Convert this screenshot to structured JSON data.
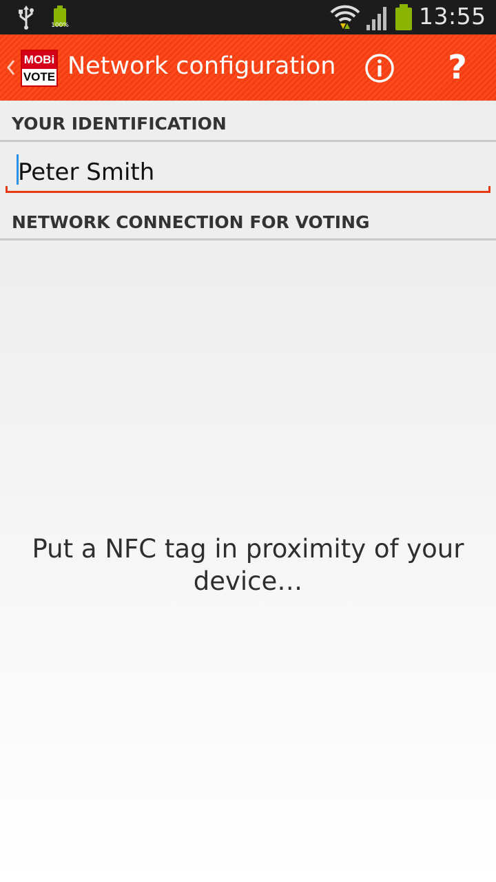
{
  "status_bar": {
    "time": "13:55",
    "battery_small_label": "100%",
    "icons": [
      "usb-icon",
      "battery-full-icon",
      "wifi-icon",
      "signal-icon",
      "battery-icon"
    ]
  },
  "action_bar": {
    "logo": {
      "top": "MOBi",
      "bottom": "VOTE"
    },
    "title": "Network configuration",
    "help_label": "?"
  },
  "form": {
    "identification_header": "YOUR IDENTIFICATION",
    "identification_value": "Peter Smith",
    "network_header": "NETWORK CONNECTION FOR VOTING"
  },
  "nfc": {
    "message": "Put a NFC tag in proximity of your device…"
  },
  "colors": {
    "action_bar": "#f44316",
    "status_bar": "#1c1c1c",
    "battery": "#8ab400",
    "field_underline": "#e53a12",
    "cursor": "#2a8fe6"
  }
}
